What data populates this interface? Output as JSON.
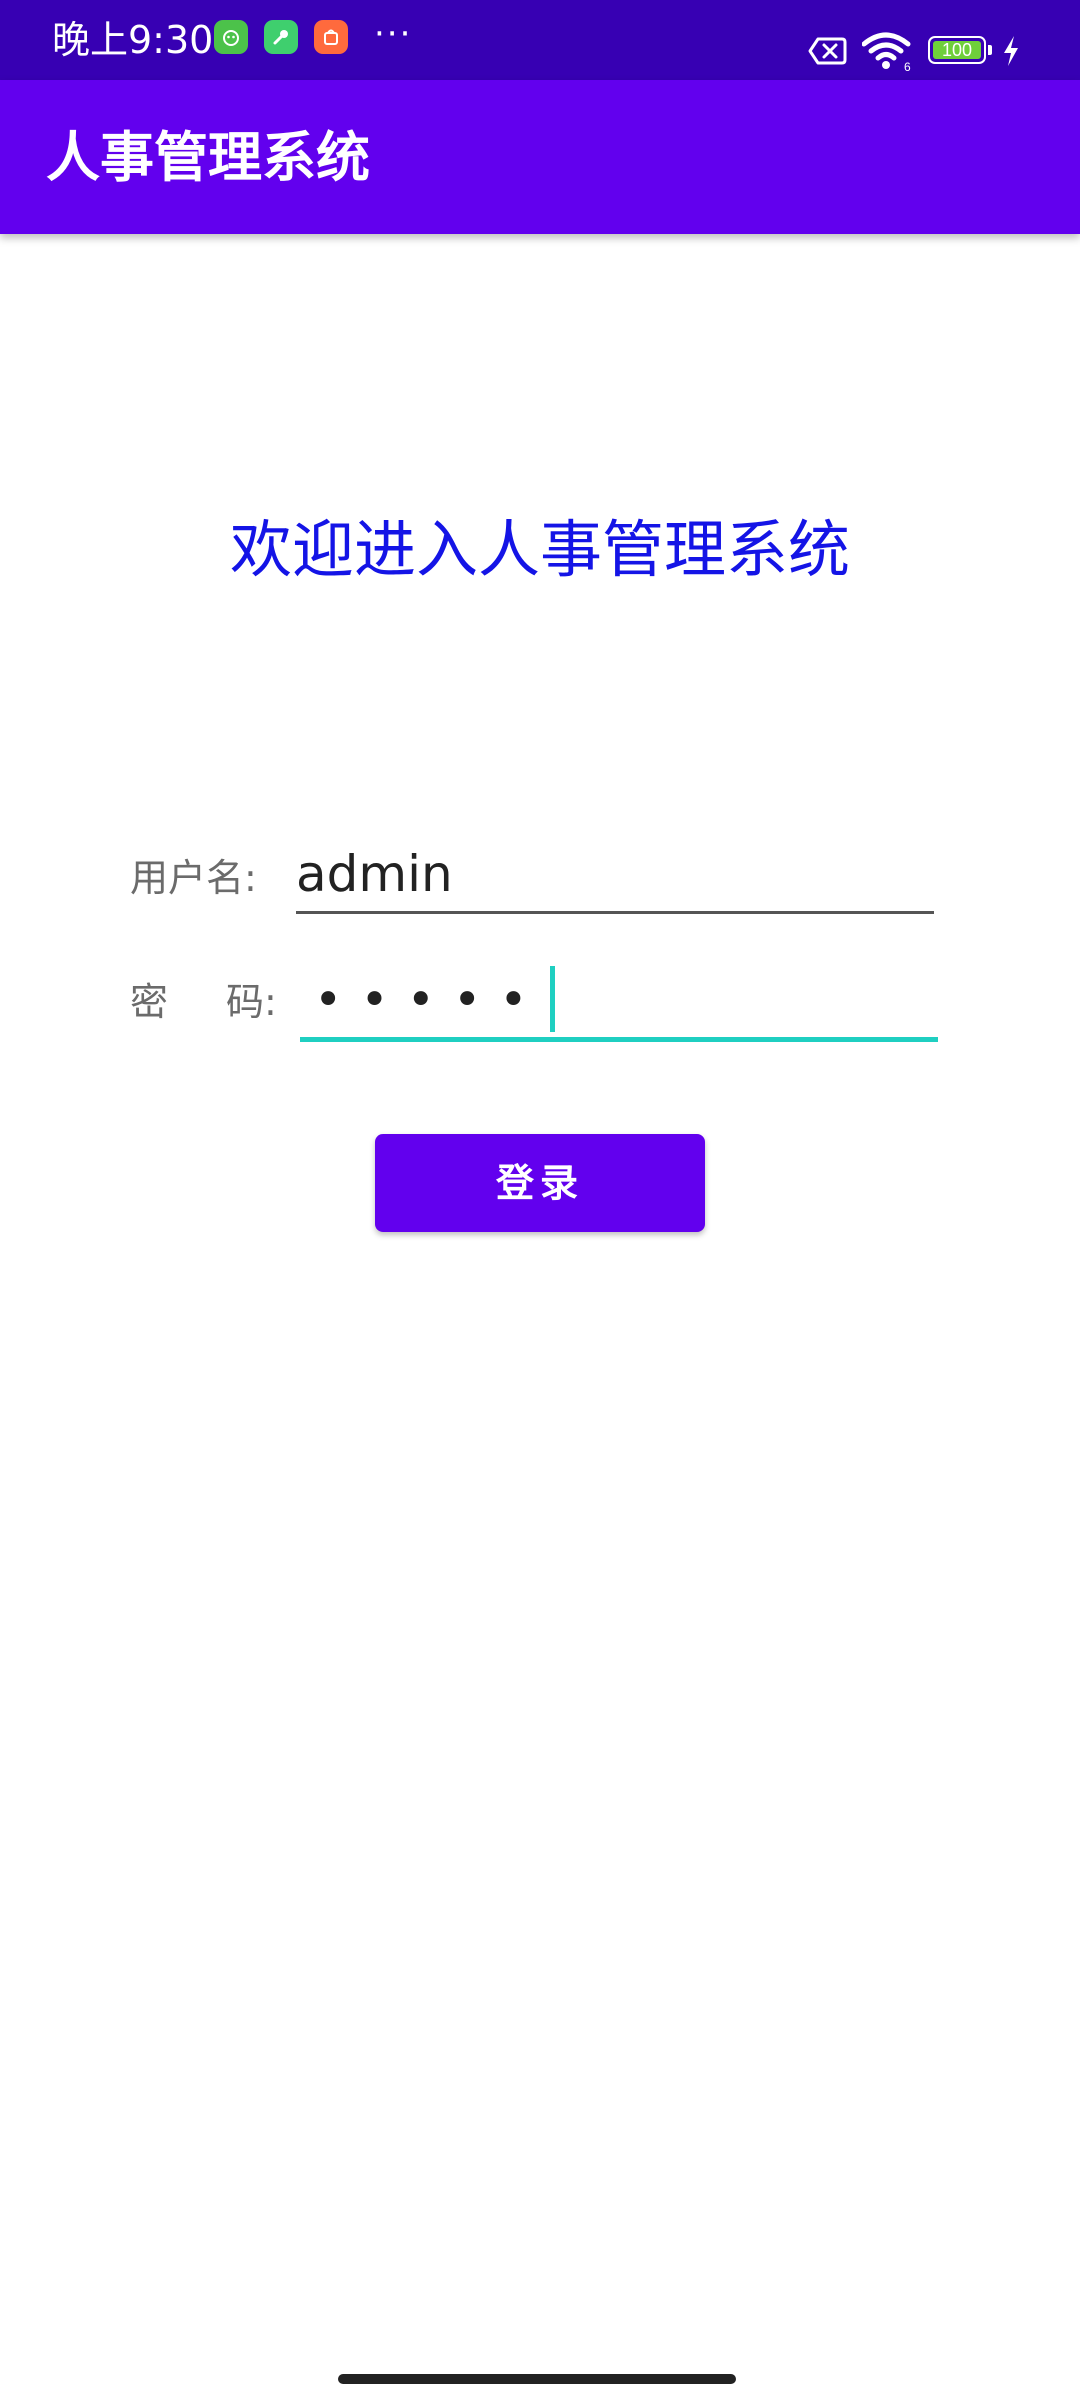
{
  "status_bar": {
    "time": "晚上9:30",
    "more": "···",
    "battery_level": "100",
    "icons": [
      "app-notification-icon",
      "tool-notification-icon",
      "shop-notification-icon",
      "no-sim-icon",
      "wifi-icon",
      "battery-icon",
      "charging-icon"
    ],
    "background": "#3700b3"
  },
  "app_bar": {
    "title": "人事管理系统",
    "background": "#6200ee"
  },
  "main": {
    "welcome": "欢迎进入人事管理系统",
    "welcome_color": "#1414e6",
    "username_label": "用户名:",
    "username_value": "admin",
    "password_label_1": "密",
    "password_label_2": "码:",
    "password_masked": "•••••",
    "focus_color": "#1fcfc1",
    "login_label": "登录"
  }
}
